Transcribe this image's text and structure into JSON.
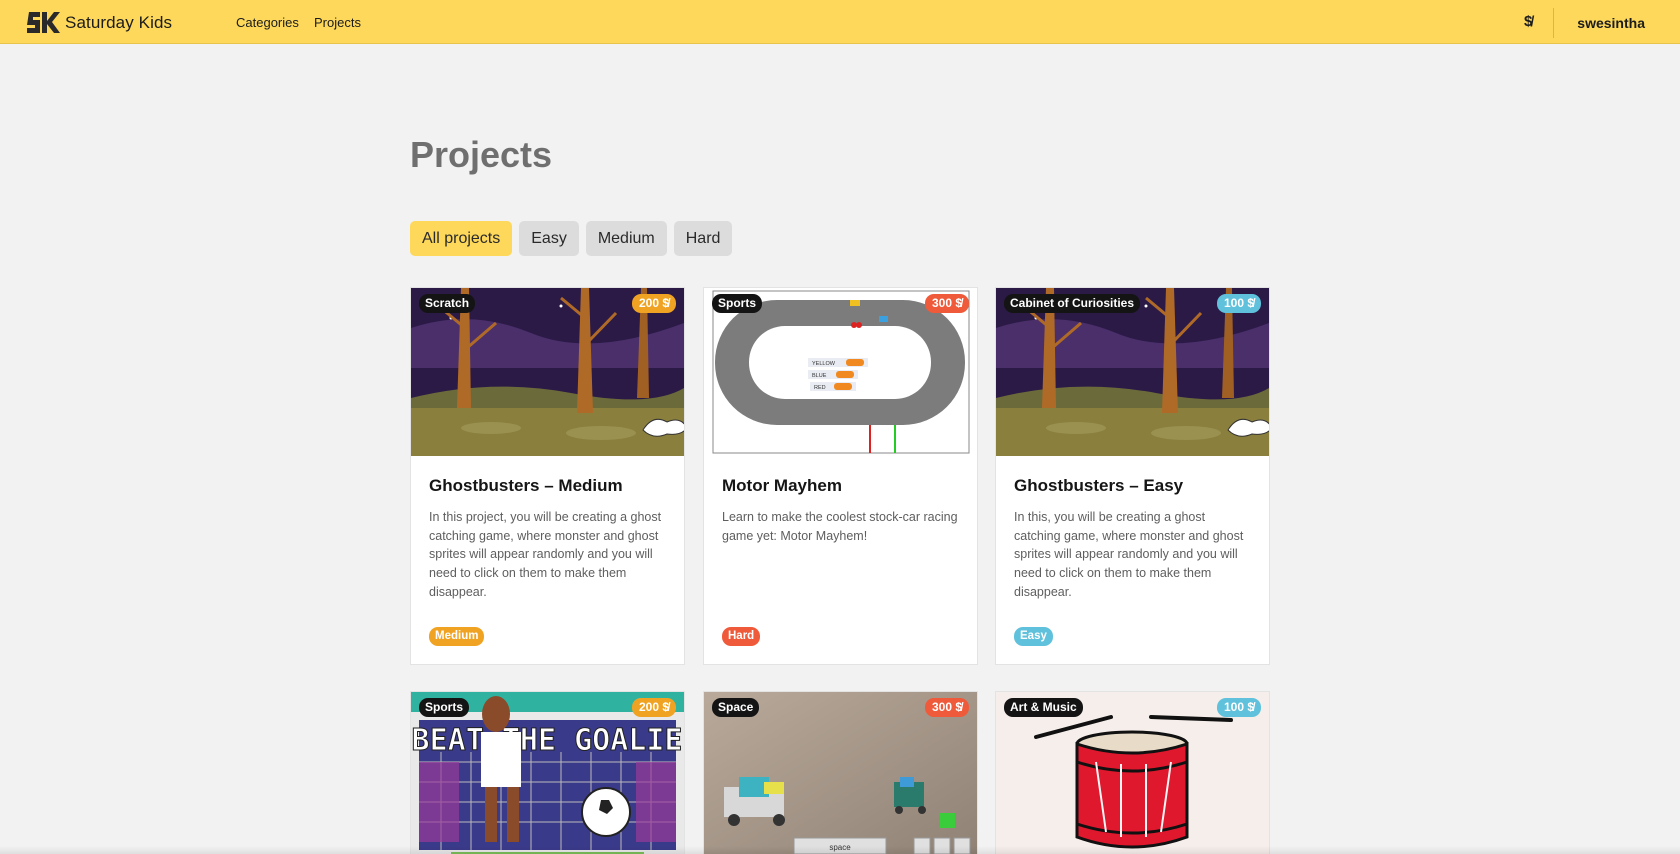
{
  "colors": {
    "navbar": "#fdd85a",
    "active_filter": "#fdd85a",
    "medium": "#f0a323",
    "hard": "#ef5a3a",
    "easy": "#5fc1db"
  },
  "navbar": {
    "brand": "Saturday Kids",
    "links": [
      "Categories",
      "Projects"
    ],
    "coin_icon": "coin-icon",
    "coin_glyph": "$̸",
    "username": "swesintha"
  },
  "page": {
    "title": "Projects",
    "filters": [
      "All projects",
      "Easy",
      "Medium",
      "Hard"
    ],
    "active_filter": "All projects"
  },
  "projects": [
    {
      "category": "Scratch",
      "price": "200 $̸",
      "title": "Ghostbusters – Medium",
      "description": "In this project, you will be creating a ghost catching game, where monster and ghost sprites will appear randomly and you will need to click on them to make them disappear.",
      "level": "Medium",
      "thumbnail": "forest-scene-image"
    },
    {
      "category": "Sports",
      "price": "300 $̸",
      "title": "Motor Mayhem",
      "description": "Learn to make the coolest stock-car racing game yet: Motor Mayhem!",
      "level": "Hard",
      "thumbnail": "race-track-image",
      "thumbnail_labels": [
        "YELLOW",
        "BLUE",
        "RED"
      ]
    },
    {
      "category": "Cabinet of Curiosities",
      "price": "100 $̸",
      "title": "Ghostbusters – Easy",
      "description": "In this, you will be creating a ghost catching game, where monster and ghost sprites will appear randomly and you will need to click on them to make them disappear.",
      "level": "Easy",
      "thumbnail": "forest-scene-image"
    },
    {
      "category": "Sports",
      "price": "200 $̸",
      "thumbnail": "beat-the-goalie-image",
      "thumbnail_text": "BEAT THE GOALIE"
    },
    {
      "category": "Space",
      "price": "300 $̸",
      "thumbnail": "robots-photo-image",
      "thumbnail_text": "space"
    },
    {
      "category": "Art & Music",
      "price": "100 $̸",
      "thumbnail": "drum-image"
    }
  ]
}
